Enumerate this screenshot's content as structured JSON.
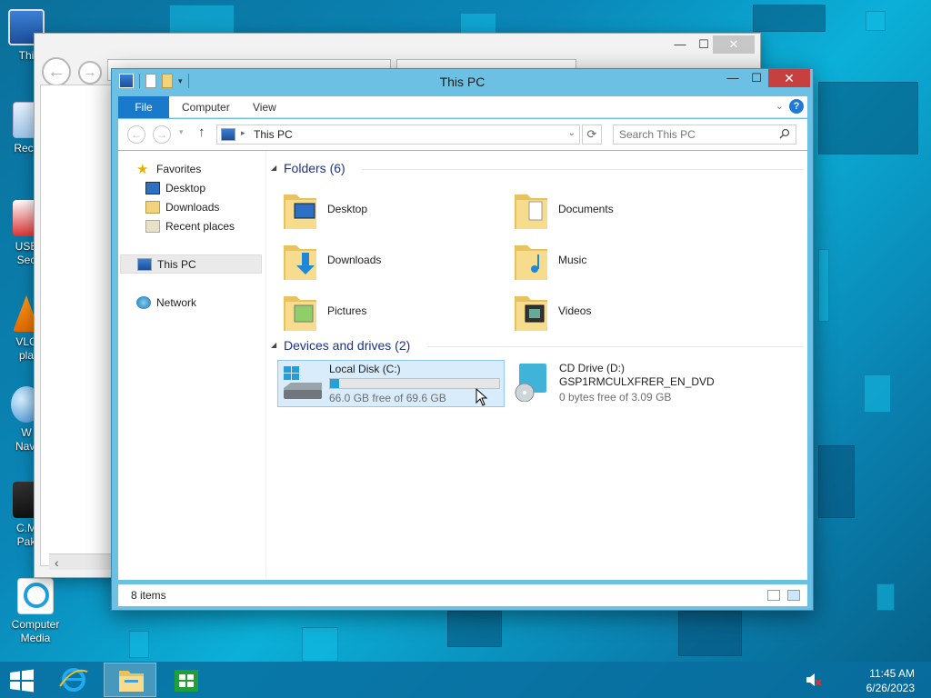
{
  "desktop": {
    "icons": [
      {
        "label": "Thi",
        "icon": "this-pc-icon"
      },
      {
        "label": "Recy",
        "icon": "recycle-bin-icon"
      },
      {
        "label": "USB\nSec",
        "icon": "usb-security-icon"
      },
      {
        "label": "VLC\npla",
        "icon": "vlc-icon"
      },
      {
        "label": "W\nNavi",
        "icon": "globe-navigator-icon"
      },
      {
        "label": "C.M\nPak",
        "icon": "cm-icon"
      },
      {
        "label": "Computer\nMedia",
        "icon": "internet-explorer-icon"
      }
    ]
  },
  "explorer": {
    "title": "This PC",
    "ribbon_tabs": [
      "File",
      "Computer",
      "View"
    ],
    "address": "This PC",
    "search_placeholder": "Search This PC",
    "nav_pane": {
      "favorites": "Favorites",
      "desktop": "Desktop",
      "downloads": "Downloads",
      "recent": "Recent places",
      "this_pc": "This PC",
      "network": "Network"
    },
    "folders_header": "Folders (6)",
    "folders": [
      "Desktop",
      "Documents",
      "Downloads",
      "Music",
      "Pictures",
      "Videos"
    ],
    "devices_header": "Devices and drives (2)",
    "drives": [
      {
        "name": "Local Disk (C:)",
        "free": "66.0 GB free of 69.6 GB",
        "used_fraction": 0.052
      },
      {
        "name": "CD Drive (D:)",
        "label": "GSP1RMCULXFRER_EN_DVD",
        "free": "0 bytes free of 3.09 GB"
      }
    ],
    "status": "8 items"
  },
  "taskbar": {
    "time": "11:45 AM",
    "date": "6/26/2023"
  },
  "colors": {
    "accent": "#1979ca",
    "window_frame": "#6cc0e3",
    "close_red": "#c74040",
    "drive_bar": "#26a0da"
  }
}
